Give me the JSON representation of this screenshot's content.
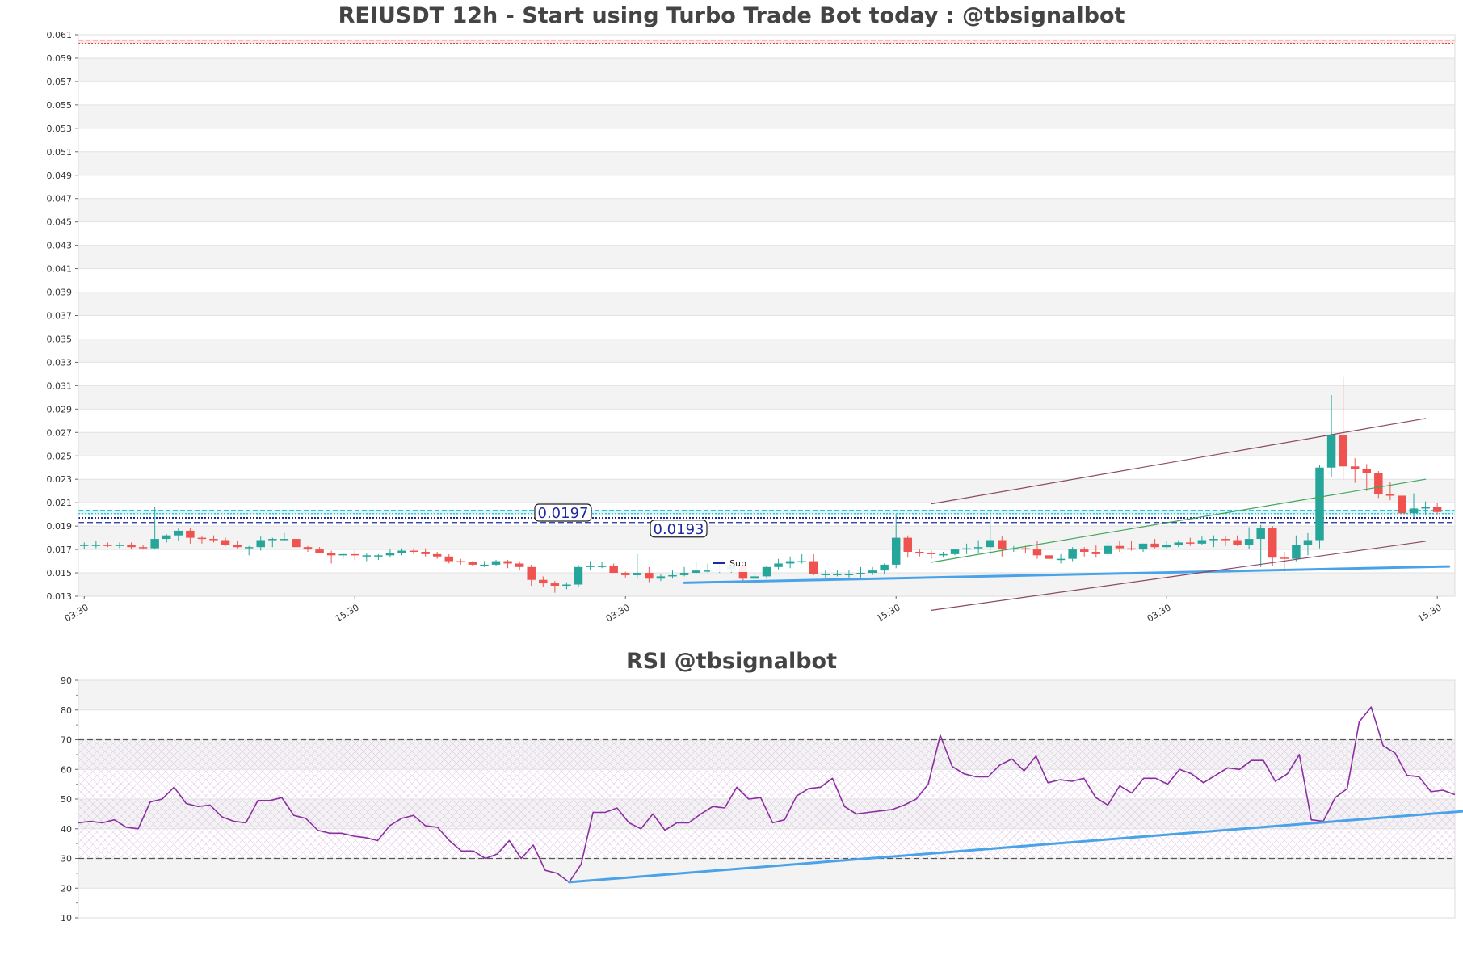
{
  "main_title": "REIUSDT 12h - Start using Turbo Trade Bot today : @tbsignalbot",
  "rsi_title": "RSI @tbsignalbot",
  "colors": {
    "up": "#26a69a",
    "down": "#ef5350",
    "trend_blue": "#4aa3e8",
    "channel": "#8b4a62",
    "green_line": "#3fa65a",
    "rsi_line": "#8b2ea0",
    "resistance_red": "#d62728",
    "support_cyan": "#17becf",
    "level_navy": "#1f2aa0"
  },
  "labels": {
    "level_1": "0.0197",
    "level_2": "0.0193",
    "legend_sup": "Sup"
  },
  "chart_data": [
    {
      "type": "candlestick",
      "title": "REIUSDT 12h - Start using Turbo Trade Bot today : @tbsignalbot",
      "ylim": [
        0.013,
        0.061
      ],
      "yticks": [
        "0.013",
        "0.015",
        "0.017",
        "0.019",
        "0.021",
        "0.023",
        "0.025",
        "0.027",
        "0.029",
        "0.031",
        "0.033",
        "0.035",
        "0.037",
        "0.039",
        "0.041",
        "0.043",
        "0.045",
        "0.047",
        "0.049",
        "0.051",
        "0.053",
        "0.055",
        "0.057",
        "0.059",
        "0.061"
      ],
      "xticks": [
        {
          "label": "03:30",
          "index": 0
        },
        {
          "label": "15:30",
          "index": 23
        },
        {
          "label": "03:30",
          "index": 46
        },
        {
          "label": "15:30",
          "index": 69
        },
        {
          "label": "03:30",
          "index": 92
        },
        {
          "label": "15:30",
          "index": 115
        }
      ],
      "x_count": 117,
      "horizontal_levels": [
        {
          "value": 0.0604,
          "style": "resistance"
        },
        {
          "value": 0.0202,
          "style": "support-band"
        },
        {
          "value": 0.0197,
          "style": "dotted",
          "label": "0.0197"
        },
        {
          "value": 0.0193,
          "style": "dashed",
          "label": "0.0193"
        }
      ],
      "trendlines": [
        {
          "name": "Sup",
          "x": [
            51,
            116
          ],
          "y": [
            0.01415,
            0.01555
          ],
          "style": "support"
        },
        {
          "x": [
            72,
            114
          ],
          "y": [
            0.0209,
            0.0282
          ],
          "style": "channel"
        },
        {
          "x": [
            72,
            114
          ],
          "y": [
            0.0118,
            0.0177
          ],
          "style": "channel"
        },
        {
          "x": [
            72,
            114
          ],
          "y": [
            0.0159,
            0.023
          ],
          "style": "green"
        }
      ],
      "legend": [
        "Sup"
      ],
      "candles": {
        "open": [
          0.0173,
          0.0174,
          0.0174,
          0.0173,
          0.0174,
          0.0172,
          0.0171,
          0.0179,
          0.0182,
          0.0186,
          0.018,
          0.0179,
          0.0178,
          0.0174,
          0.0172,
          0.0172,
          0.0178,
          0.0179,
          0.0179,
          0.0172,
          0.017,
          0.0167,
          0.0165,
          0.0166,
          0.0165,
          0.0165,
          0.0165,
          0.0167,
          0.0169,
          0.0168,
          0.0166,
          0.0164,
          0.016,
          0.0159,
          0.0157,
          0.0157,
          0.016,
          0.0158,
          0.0155,
          0.0144,
          0.0141,
          0.0139,
          0.014,
          0.0155,
          0.0156,
          0.0156,
          0.015,
          0.0148,
          0.015,
          0.0145,
          0.0147,
          0.0148,
          0.015,
          0.0152,
          0.0152,
          0.0153,
          0.0156,
          0.0145,
          0.0147,
          0.0155,
          0.0158,
          0.016,
          0.016,
          0.0149,
          0.0149,
          0.0149,
          0.0149,
          0.015,
          0.0152,
          0.0157,
          0.018,
          0.0168,
          0.0167,
          0.0166,
          0.0166,
          0.017,
          0.0171,
          0.0172,
          0.0178,
          0.017,
          0.0171,
          0.017,
          0.0165,
          0.0162,
          0.0162,
          0.017,
          0.0168,
          0.0166,
          0.0173,
          0.0171,
          0.017,
          0.0175,
          0.0172,
          0.0174,
          0.0176,
          0.0175,
          0.0178,
          0.0179,
          0.0178,
          0.0174,
          0.0179,
          0.0188,
          0.0163,
          0.0162,
          0.0174,
          0.0178,
          0.024,
          0.0268,
          0.0241,
          0.0239,
          0.0235,
          0.0217,
          0.0216,
          0.0201,
          0.0205,
          0.0206
        ],
        "high": [
          0.0176,
          0.0177,
          0.0176,
          0.0176,
          0.0176,
          0.0174,
          0.0206,
          0.0183,
          0.0188,
          0.0188,
          0.0181,
          0.0182,
          0.018,
          0.0177,
          0.0173,
          0.0181,
          0.018,
          0.0184,
          0.018,
          0.0173,
          0.0172,
          0.0169,
          0.0167,
          0.0169,
          0.0167,
          0.0166,
          0.017,
          0.0171,
          0.0171,
          0.0171,
          0.0168,
          0.0166,
          0.0162,
          0.016,
          0.016,
          0.0161,
          0.0161,
          0.016,
          0.0157,
          0.0147,
          0.0143,
          0.0142,
          0.0157,
          0.016,
          0.0159,
          0.0158,
          0.0151,
          0.0166,
          0.0155,
          0.0149,
          0.0152,
          0.0155,
          0.016,
          0.0158,
          0.016,
          0.0158,
          0.0157,
          0.0158,
          0.0156,
          0.0162,
          0.0164,
          0.0166,
          0.0166,
          0.0152,
          0.0152,
          0.0152,
          0.0155,
          0.0155,
          0.0158,
          0.02,
          0.0182,
          0.017,
          0.0169,
          0.0168,
          0.017,
          0.0175,
          0.0178,
          0.0203,
          0.0181,
          0.0173,
          0.0173,
          0.0177,
          0.0168,
          0.0166,
          0.0172,
          0.0172,
          0.0174,
          0.0176,
          0.0177,
          0.0177,
          0.0175,
          0.0179,
          0.0177,
          0.0178,
          0.018,
          0.0181,
          0.0182,
          0.0181,
          0.0182,
          0.0189,
          0.0191,
          0.019,
          0.0168,
          0.0182,
          0.0184,
          0.0242,
          0.0302,
          0.0318,
          0.0248,
          0.0243,
          0.0237,
          0.0228,
          0.0219,
          0.0218,
          0.0211,
          0.021
        ],
        "low": [
          0.017,
          0.0171,
          0.0172,
          0.0171,
          0.017,
          0.017,
          0.017,
          0.0176,
          0.0177,
          0.0175,
          0.0175,
          0.0176,
          0.0173,
          0.0171,
          0.0165,
          0.0169,
          0.0172,
          0.0177,
          0.0173,
          0.0168,
          0.0167,
          0.0158,
          0.0162,
          0.0161,
          0.016,
          0.0161,
          0.0163,
          0.0165,
          0.0166,
          0.0164,
          0.0162,
          0.0158,
          0.0157,
          0.0156,
          0.0155,
          0.0156,
          0.0154,
          0.0152,
          0.0139,
          0.0138,
          0.0133,
          0.0136,
          0.0138,
          0.0152,
          0.0154,
          0.015,
          0.0146,
          0.0145,
          0.0142,
          0.0143,
          0.0145,
          0.0147,
          0.0149,
          0.015,
          0.015,
          0.015,
          0.0143,
          0.0143,
          0.0145,
          0.0153,
          0.0154,
          0.0158,
          0.0148,
          0.0146,
          0.0147,
          0.0146,
          0.0146,
          0.0148,
          0.0149,
          0.0154,
          0.0163,
          0.0164,
          0.0162,
          0.0163,
          0.0165,
          0.0166,
          0.0167,
          0.0165,
          0.0164,
          0.0168,
          0.0167,
          0.0162,
          0.016,
          0.0158,
          0.016,
          0.0164,
          0.0163,
          0.0164,
          0.0168,
          0.0169,
          0.0168,
          0.0171,
          0.017,
          0.0172,
          0.0173,
          0.0174,
          0.0172,
          0.0173,
          0.0173,
          0.017,
          0.0155,
          0.0156,
          0.0151,
          0.016,
          0.0165,
          0.0171,
          0.0232,
          0.023,
          0.0227,
          0.022,
          0.0214,
          0.0212,
          0.0198,
          0.0197,
          0.0199,
          0.02
        ],
        "close": [
          0.0174,
          0.0174,
          0.0173,
          0.0174,
          0.0172,
          0.0171,
          0.0179,
          0.0182,
          0.0186,
          0.018,
          0.0179,
          0.0178,
          0.0174,
          0.0172,
          0.0172,
          0.0178,
          0.0179,
          0.0179,
          0.0172,
          0.017,
          0.0167,
          0.0165,
          0.0166,
          0.0165,
          0.0165,
          0.0165,
          0.0167,
          0.0169,
          0.0168,
          0.0166,
          0.0164,
          0.016,
          0.0159,
          0.0157,
          0.0157,
          0.016,
          0.0158,
          0.0155,
          0.0144,
          0.0141,
          0.0139,
          0.014,
          0.0155,
          0.0156,
          0.0156,
          0.015,
          0.0148,
          0.015,
          0.0145,
          0.0147,
          0.0148,
          0.015,
          0.0152,
          0.0152,
          0.0153,
          0.0156,
          0.0145,
          0.0147,
          0.0155,
          0.0158,
          0.016,
          0.016,
          0.0149,
          0.0149,
          0.0149,
          0.0149,
          0.015,
          0.0152,
          0.0157,
          0.018,
          0.0168,
          0.0167,
          0.0166,
          0.0166,
          0.017,
          0.0171,
          0.0172,
          0.0178,
          0.017,
          0.0171,
          0.017,
          0.0165,
          0.0162,
          0.0162,
          0.017,
          0.0168,
          0.0166,
          0.0173,
          0.0171,
          0.017,
          0.0175,
          0.0172,
          0.0174,
          0.0176,
          0.0175,
          0.0178,
          0.0179,
          0.0178,
          0.0174,
          0.0179,
          0.0188,
          0.0163,
          0.0162,
          0.0174,
          0.0178,
          0.024,
          0.0268,
          0.0241,
          0.0239,
          0.0235,
          0.0217,
          0.0216,
          0.0201,
          0.0205,
          0.0206,
          0.0202
        ]
      }
    },
    {
      "type": "line",
      "title": "RSI @tbsignalbot",
      "ylim": [
        10,
        90
      ],
      "yticks": [
        "10",
        "20",
        "30",
        "40",
        "50",
        "60",
        "70",
        "80",
        "90"
      ],
      "reference_lines": [
        30,
        70
      ],
      "trendline": {
        "x": [
          41,
          116
        ],
        "y": [
          22,
          46
        ]
      },
      "values": [
        42,
        42.5,
        42,
        43,
        40.5,
        40,
        49,
        50,
        54,
        48.5,
        47.5,
        48,
        44,
        42.5,
        42,
        49.5,
        49.5,
        50.5,
        44.5,
        43.5,
        39.5,
        38.5,
        38.5,
        37.5,
        37,
        36,
        41,
        43.5,
        44.5,
        41,
        40.5,
        36,
        32.5,
        32.5,
        30,
        31.5,
        36,
        30,
        34.5,
        26,
        25,
        22,
        28,
        45.5,
        45.5,
        47,
        42,
        40,
        45,
        39.5,
        42,
        42,
        45,
        47.5,
        47,
        54,
        50,
        50.5,
        42,
        43,
        51,
        53.5,
        54,
        57,
        47.5,
        45,
        45.5,
        46,
        46.5,
        48,
        50,
        55,
        71.5,
        61,
        58.5,
        57.5,
        57.5,
        61.5,
        63.5,
        59.5,
        64.5,
        55.5,
        56.5,
        56,
        57,
        50.5,
        48,
        54.5,
        52,
        57,
        57,
        55,
        60,
        58.5,
        55.5,
        58,
        60.5,
        60,
        63,
        63,
        56,
        58.5,
        65,
        43,
        42.5,
        50.5,
        53.5,
        76,
        81,
        68,
        65.5,
        58,
        57.5,
        52.5,
        53,
        51.5
      ]
    }
  ]
}
